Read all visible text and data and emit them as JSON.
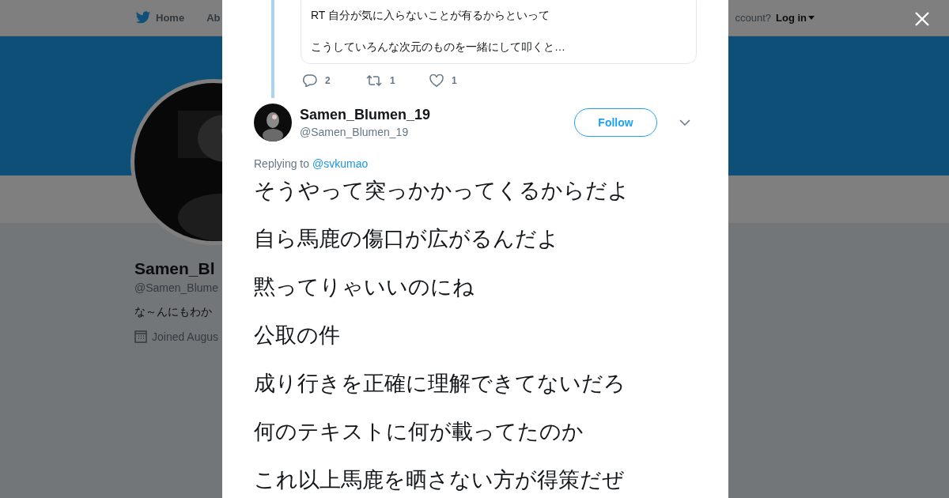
{
  "nav": {
    "items": [
      {
        "label": "Home",
        "kind": "home"
      },
      {
        "label": "Ab",
        "kind": "plain"
      }
    ],
    "account_prompt": "ccount?",
    "login": "Log in"
  },
  "profile": {
    "name": "Samen_Bl",
    "handle": "@Samen_Blume",
    "bio": "な～んにもわか",
    "joined": "Joined Augus"
  },
  "modal": {
    "quoted": {
      "lines": [
        "RT 自分が気に入らないことが有るからといって",
        "こうしていろんな次元のものを一緒にして叩くと…"
      ]
    },
    "actions": [
      {
        "kind": "reply",
        "count": "2"
      },
      {
        "kind": "retweet",
        "count": "1"
      },
      {
        "kind": "like",
        "count": "1"
      }
    ],
    "tweet": {
      "name": "Samen_Blumen_19",
      "handle": "@Samen_Blumen_19",
      "follow": "Follow",
      "replying_label": "Replying to",
      "replying_to": "@svkumao",
      "paragraphs": [
        "そうやって突っかかってくるからだよ",
        "自ら馬鹿の傷口が広がるんだよ",
        "黙ってりゃいいのにね",
        "公取の件",
        "成り行きを正確に理解できてないだろ",
        "何のテキストに何が載ってたのか",
        "これ以上馬鹿を晒さない方が得策だぜ"
      ]
    }
  }
}
